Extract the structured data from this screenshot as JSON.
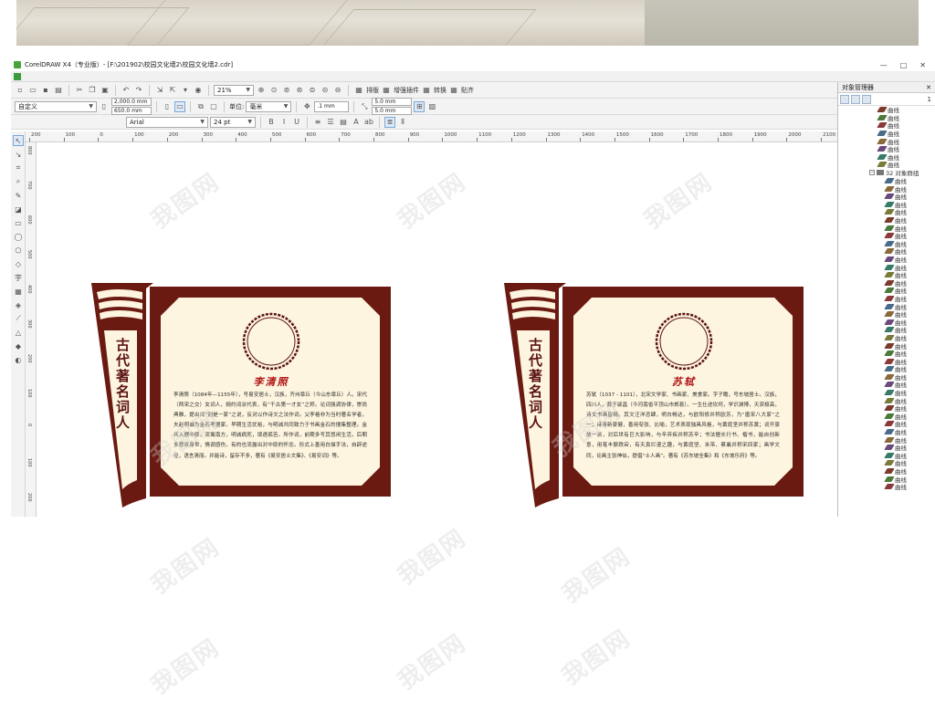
{
  "window": {
    "title": "CorelDRAW X4（专业版）- [F:\\201902\\校园文化墙2\\校园文化墙2.cdr]",
    "controls": [
      "—",
      "□",
      "✕"
    ]
  },
  "toolbar1": {
    "zoom": "21%",
    "btn_layout": "排版",
    "btn_plugins": "增强插件",
    "btn_convert": "转换",
    "btn_paste": "贴齐"
  },
  "toolbar2": {
    "preset": "自定义",
    "width": "2,000.0 mm",
    "height": "650.0 mm",
    "units_label": "单位:",
    "units": "毫米",
    "nudge": ".1 mm",
    "dup_x": "5.0 mm",
    "dup_y": "5.0 mm"
  },
  "toolbar3": {
    "font": "Arial",
    "size": "24 pt"
  },
  "ruler": {
    "h_ticks": [
      "200",
      "100",
      "0",
      "100",
      "200",
      "300",
      "400",
      "500",
      "600",
      "700",
      "800",
      "900",
      "1000",
      "1100",
      "1200",
      "1300",
      "1400",
      "1500",
      "1600",
      "1700",
      "1800",
      "1900",
      "2000",
      "2100"
    ],
    "v_ticks": [
      "800",
      "700",
      "600",
      "500",
      "400",
      "300",
      "200",
      "100",
      "0",
      "100",
      "200"
    ]
  },
  "docker": {
    "title": "对象管理器",
    "layer": "1",
    "group_label": "32 对象群组",
    "item_label": "曲线",
    "top_items": 8,
    "group_items": 40
  },
  "posters": [
    {
      "side_title": "古代著名词人",
      "name": "李清照",
      "paragraph": "李清照（1084年—1155年），号易安居士，汉族，齐州章丘（今山东章丘）人。宋代（两宋之交）女词人，婉约词派代表，有“千古第一才女”之称。论词强调协律，崇尚典雅，提出词“别是一家”之说，反对以作诗文之法作词。父李格非为当时著名学者，夫赵明诚为金石考据家。早期生活优裕，与明诚共同致力于书画金石的搜集整理。金兵入据中原，流寓南方，明诚病死，境遇孤苦。所作词，前期多写其悠闲生活，后期多悲叹身世，情调感伤，有的也流露出对中原的怀念。形式上善用白描手法，自辟途径，语言清丽。并能诗，留存不多，著有《易安居士文集》、《易安词》等。"
    },
    {
      "side_title": "古代著名词人",
      "name": "苏轼",
      "paragraph": "苏轼（1037 - 1101），北宋文学家、书画家、美食家。字子瞻，号东坡居士。汉族，四川人，葬于颍昌（今河南省平顶山市郏县）。一生仕途坎坷，学识渊博，天资极高，诗文书画皆精。其文汪洋恣肆，明白畅达，与欧阳修并称欧苏，为“唐宋八大家”之一；诗清新豪健，善用夸张、比喻，艺术表现独具风格，与黄庭坚并称苏黄；词开豪放一派，对后世有巨大影响，与辛弃疾并称苏辛；书法擅长行书、楷书，能自创新意，用笔丰腴跌宕，有天真烂漫之趣，与黄庭坚、米芾、蔡襄并称宋四家；画学文同，论画主张神似，提倡“士人画”。著有《苏东坡全集》和《东坡乐府》等。"
    }
  ],
  "watermark": "我图网",
  "colors": {
    "frame": "#6b1a12",
    "panel": "#fdf5e0",
    "title_red": "#b01616",
    "title_dark": "#5b1212"
  }
}
